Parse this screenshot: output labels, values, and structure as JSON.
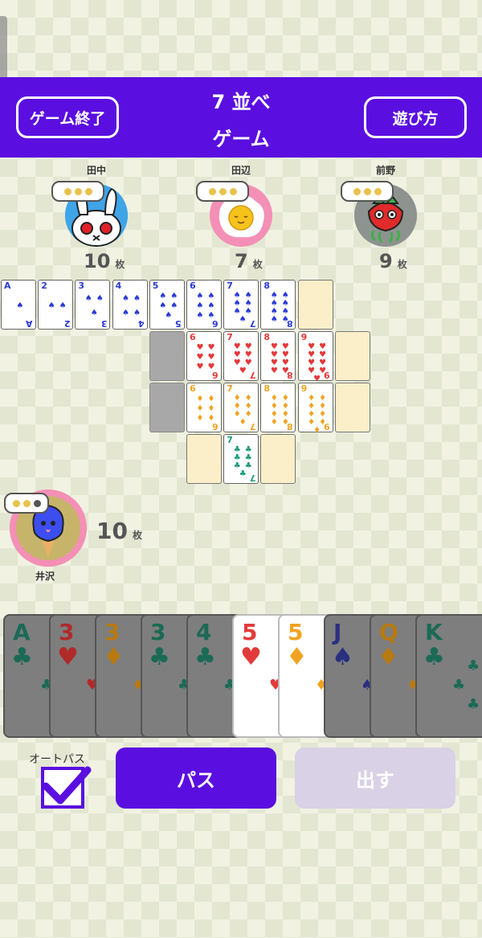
{
  "header": {
    "title_line1": "7 並べ",
    "title_line2": "ゲーム",
    "end_label": "ゲーム終了",
    "rules_label": "遊び方",
    "color": "#5a0fe0"
  },
  "opponents": [
    {
      "name": "田中",
      "count": "10",
      "unit": "枚",
      "avatar": "rabbit-avatar"
    },
    {
      "name": "田辺",
      "count": "7",
      "unit": "枚",
      "avatar": "egg-avatar"
    },
    {
      "name": "前野",
      "count": "9",
      "unit": "枚",
      "avatar": "strawberry-avatar"
    }
  ],
  "player": {
    "name": "井沢",
    "count": "10",
    "unit": "枚",
    "avatar": "octopus-avatar"
  },
  "board": {
    "spades": [
      "A",
      "2",
      "3",
      "4",
      "5",
      "6",
      "7",
      "8"
    ],
    "hearts": [
      "6",
      "7",
      "8",
      "9"
    ],
    "diamonds": [
      "6",
      "7",
      "8",
      "9"
    ],
    "clubs": [
      "7"
    ]
  },
  "hand": [
    {
      "rank": "A",
      "suit": "♣",
      "color": "green",
      "playable": false
    },
    {
      "rank": "3",
      "suit": "♥",
      "color": "red",
      "playable": false
    },
    {
      "rank": "3",
      "suit": "♦",
      "color": "orange",
      "playable": false
    },
    {
      "rank": "3",
      "suit": "♣",
      "color": "green",
      "playable": false
    },
    {
      "rank": "4",
      "suit": "♣",
      "color": "green",
      "playable": false
    },
    {
      "rank": "5",
      "suit": "♥",
      "color": "red",
      "playable": true
    },
    {
      "rank": "5",
      "suit": "♦",
      "color": "orange",
      "playable": true
    },
    {
      "rank": "J",
      "suit": "♠",
      "color": "blue",
      "playable": false
    },
    {
      "rank": "Q",
      "suit": "♦",
      "color": "orange",
      "playable": false
    },
    {
      "rank": "K",
      "suit": "♣",
      "color": "green",
      "playable": false
    }
  ],
  "controls": {
    "autopass_label": "オートパス",
    "pass_label": "パス",
    "play_label": "出す"
  }
}
